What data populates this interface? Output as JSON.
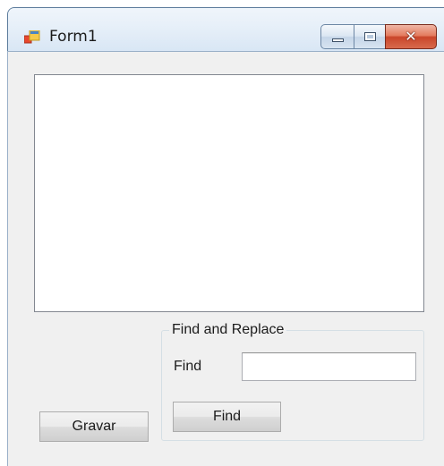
{
  "window": {
    "title": "Form1",
    "icon": "form-app-icon",
    "caption_buttons": {
      "minimize_icon": "minimize-icon",
      "maximize_icon": "maximize-icon",
      "close_icon": "close-icon",
      "close_glyph": "✕"
    }
  },
  "main_text": {
    "value": ""
  },
  "find_replace_group": {
    "title": "Find and Replace",
    "find_label": "Find",
    "find_value": "",
    "find_button_label": "Find"
  },
  "gravar_button_label": "Gravar",
  "colors": {
    "close_button": "#c9452a",
    "client_background": "#f0f0f0",
    "frame": "#c6d9ee"
  }
}
